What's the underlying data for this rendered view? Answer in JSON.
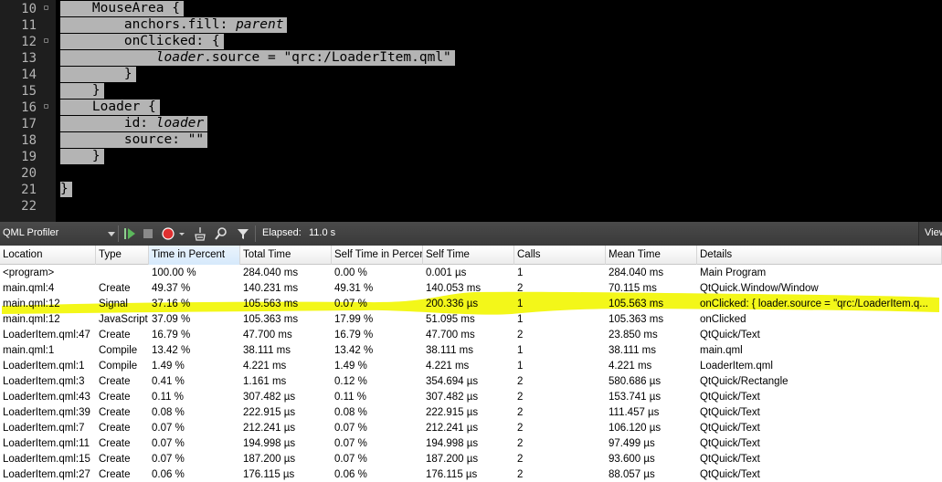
{
  "editor": {
    "lines": [
      {
        "num": "10",
        "fold": true,
        "segments": [
          {
            "t": "    MouseArea {"
          }
        ]
      },
      {
        "num": "11",
        "fold": false,
        "segments": [
          {
            "t": "        anchors.fill: "
          },
          {
            "t": "parent",
            "i": true
          }
        ]
      },
      {
        "num": "12",
        "fold": true,
        "segments": [
          {
            "t": "        onClicked: {"
          }
        ]
      },
      {
        "num": "13",
        "fold": false,
        "segments": [
          {
            "t": "            "
          },
          {
            "t": "loader",
            "i": true
          },
          {
            "t": ".source = \"qrc:/LoaderItem.qml\""
          }
        ]
      },
      {
        "num": "14",
        "fold": false,
        "segments": [
          {
            "t": "        }"
          }
        ]
      },
      {
        "num": "15",
        "fold": false,
        "segments": [
          {
            "t": "    }"
          }
        ]
      },
      {
        "num": "16",
        "fold": true,
        "segments": [
          {
            "t": "    Loader {"
          }
        ]
      },
      {
        "num": "17",
        "fold": false,
        "segments": [
          {
            "t": "        id: "
          },
          {
            "t": "loader",
            "i": true
          }
        ]
      },
      {
        "num": "18",
        "fold": false,
        "segments": [
          {
            "t": "        source: \"\""
          }
        ]
      },
      {
        "num": "19",
        "fold": false,
        "segments": [
          {
            "t": "    }"
          }
        ]
      },
      {
        "num": "20",
        "fold": false,
        "segments": []
      },
      {
        "num": "21",
        "fold": false,
        "segments": [
          {
            "t": "}"
          }
        ]
      },
      {
        "num": "22",
        "fold": false,
        "segments": []
      }
    ]
  },
  "toolbar": {
    "title": "QML Profiler",
    "elapsed_label": "Elapsed:",
    "elapsed_value": "11.0 s",
    "view_label": "View",
    "icons": [
      "dropdown-icon",
      "run-icon",
      "stop-icon",
      "record-icon",
      "record-menu-icon",
      "clear-icon",
      "search-icon",
      "filter-icon"
    ]
  },
  "table": {
    "columns": [
      "Location",
      "Type",
      "Time in Percent",
      "Total Time",
      "Self Time in Percent",
      "Self Time",
      "Calls",
      "Mean Time",
      "Details"
    ],
    "sorted_column": "Time in Percent",
    "rows": [
      [
        "<program>",
        "",
        "100.00 %",
        "284.040 ms",
        "0.00 %",
        "0.001 µs",
        "1",
        "284.040 ms",
        "Main Program"
      ],
      [
        "main.qml:4",
        "Create",
        "49.37 %",
        "140.231 ms",
        "49.31 %",
        "140.053 ms",
        "2",
        "70.115 ms",
        "QtQuick.Window/Window"
      ],
      [
        "main.qml:12",
        "Signal",
        "37.16 %",
        "105.563 ms",
        "0.07 %",
        "200.336 µs",
        "1",
        "105.563 ms",
        "onClicked: { loader.source = \"qrc:/LoaderItem.q..."
      ],
      [
        "main.qml:12",
        "JavaScript",
        "37.09 %",
        "105.363 ms",
        "17.99 %",
        "51.095 ms",
        "1",
        "105.363 ms",
        "onClicked"
      ],
      [
        "LoaderItem.qml:47",
        "Create",
        "16.79 %",
        "47.700 ms",
        "16.79 %",
        "47.700 ms",
        "2",
        "23.850 ms",
        "QtQuick/Text"
      ],
      [
        "main.qml:1",
        "Compile",
        "13.42 %",
        "38.111 ms",
        "13.42 %",
        "38.111 ms",
        "1",
        "38.111 ms",
        "main.qml"
      ],
      [
        "LoaderItem.qml:1",
        "Compile",
        "1.49 %",
        "4.221 ms",
        "1.49 %",
        "4.221 ms",
        "1",
        "4.221 ms",
        "LoaderItem.qml"
      ],
      [
        "LoaderItem.qml:3",
        "Create",
        "0.41 %",
        "1.161 ms",
        "0.12 %",
        "354.694 µs",
        "2",
        "580.686 µs",
        "QtQuick/Rectangle"
      ],
      [
        "LoaderItem.qml:43",
        "Create",
        "0.11 %",
        "307.482 µs",
        "0.11 %",
        "307.482 µs",
        "2",
        "153.741 µs",
        "QtQuick/Text"
      ],
      [
        "LoaderItem.qml:39",
        "Create",
        "0.08 %",
        "222.915 µs",
        "0.08 %",
        "222.915 µs",
        "2",
        "111.457 µs",
        "QtQuick/Text"
      ],
      [
        "LoaderItem.qml:7",
        "Create",
        "0.07 %",
        "212.241 µs",
        "0.07 %",
        "212.241 µs",
        "2",
        "106.120 µs",
        "QtQuick/Text"
      ],
      [
        "LoaderItem.qml:11",
        "Create",
        "0.07 %",
        "194.998 µs",
        "0.07 %",
        "194.998 µs",
        "2",
        "97.499 µs",
        "QtQuick/Text"
      ],
      [
        "LoaderItem.qml:15",
        "Create",
        "0.07 %",
        "187.200 µs",
        "0.07 %",
        "187.200 µs",
        "2",
        "93.600 µs",
        "QtQuick/Text"
      ],
      [
        "LoaderItem.qml:27",
        "Create",
        "0.06 %",
        "176.115 µs",
        "0.06 %",
        "176.115 µs",
        "2",
        "88.057 µs",
        "QtQuick/Text"
      ]
    ]
  },
  "colors": {
    "editor_bg": "#000000",
    "selection_bg": "#b4b4b4",
    "toolbar_bg": "#3f3f3f",
    "highlighter": "#f2f600",
    "record": "#e03030"
  }
}
